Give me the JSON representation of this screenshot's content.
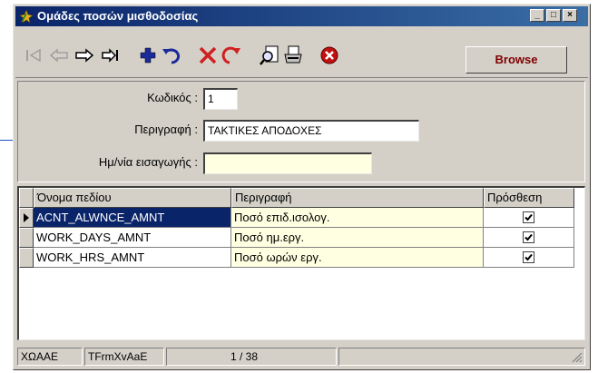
{
  "window": {
    "title": "Ομάδες ποσών μισθοδοσίας",
    "controls": {
      "minimize": "_",
      "maximize": "□",
      "close": "×"
    }
  },
  "toolbar": {
    "icons": [
      "first-record-icon",
      "prior-record-icon",
      "next-record-icon",
      "last-record-icon",
      "add-record-icon",
      "refresh-icon",
      "delete-record-icon",
      "undo-icon",
      "preview-icon",
      "print-icon",
      "close-form-icon"
    ],
    "browse_label": "Browse"
  },
  "form": {
    "code_label": "Κωδικός :",
    "code_value": "1",
    "description_label": "Περιγραφή :",
    "description_value": "ΤΑΚΤΙΚΕΣ ΑΠΟΔΟΧΕΣ",
    "entry_date_label": "Ημ/νία εισαγωγής :",
    "entry_date_value": ""
  },
  "grid": {
    "columns": [
      "Όνομα πεδίου",
      "Περιγραφή",
      "Πρόσθεση"
    ],
    "rows": [
      {
        "field": "ACNT_ALWNCE_AMNT",
        "description": "Ποσό επιδ.ισολογ.",
        "add": true
      },
      {
        "field": "WORK_DAYS_AMNT",
        "description": "Ποσό ημ.εργ.",
        "add": true
      },
      {
        "field": "WORK_HRS_AMNT",
        "description": "Ποσό ωρών εργ.",
        "add": true
      }
    ]
  },
  "status": {
    "panel1": "ΧΩΑΑΕ",
    "panel2": "TFrmXvAaE",
    "panel3": "1 / 38"
  },
  "colors": {
    "titlebar_start": "#0a246a",
    "titlebar_end": "#3a6ea5",
    "selection": "#0a246a",
    "input_highlight": "#ffffe1",
    "browse_text": "#800000"
  }
}
